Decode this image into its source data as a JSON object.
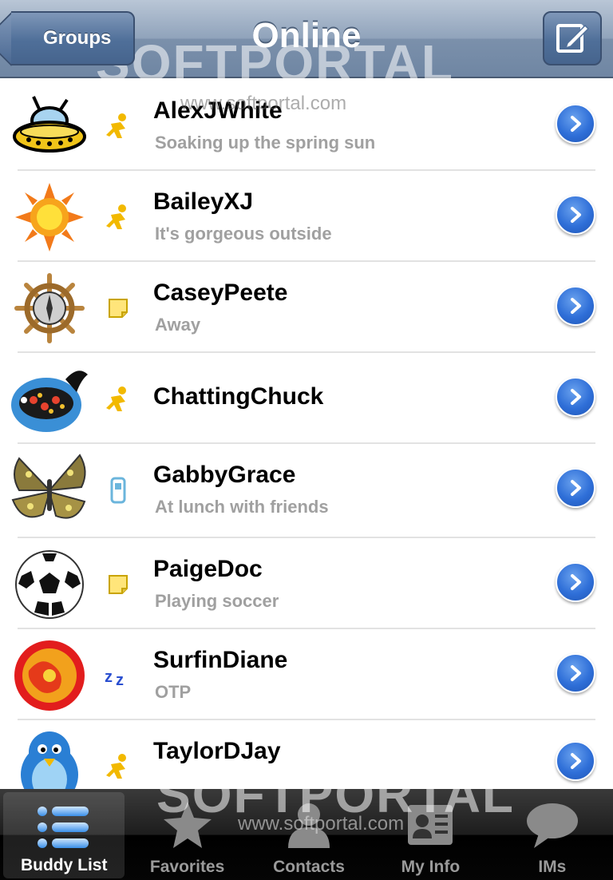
{
  "navbar": {
    "back_label": "Groups",
    "title": "Online"
  },
  "buddies": [
    {
      "name": "AlexJWhite",
      "status": "Soaking up the spring sun",
      "presence": "online-runner-icon",
      "avatar": "ufo-icon"
    },
    {
      "name": "BaileyXJ",
      "status": "It's gorgeous outside",
      "presence": "online-runner-icon",
      "avatar": "sun-icon"
    },
    {
      "name": "CaseyPeete",
      "status": "Away",
      "presence": "away-note-icon",
      "avatar": "ship-wheel-icon"
    },
    {
      "name": "ChattingChuck",
      "status": "",
      "presence": "online-runner-icon",
      "avatar": "fish-icon"
    },
    {
      "name": "GabbyGrace",
      "status": "At lunch with friends",
      "presence": "mobile-phone-icon",
      "avatar": "butterfly-icon"
    },
    {
      "name": "PaigeDoc",
      "status": "Playing soccer",
      "presence": "away-note-icon",
      "avatar": "soccer-ball-icon"
    },
    {
      "name": "SurfinDiane",
      "status": "OTP",
      "presence": "idle-zz-icon",
      "avatar": "red-flower-icon"
    },
    {
      "name": "TaylorDJay",
      "status": "",
      "presence": "online-runner-icon",
      "avatar": "penguin-icon"
    }
  ],
  "tabbar": {
    "tabs": [
      {
        "label": "Buddy List",
        "icon": "list-icon",
        "active": true
      },
      {
        "label": "Favorites",
        "icon": "star-icon",
        "active": false
      },
      {
        "label": "Contacts",
        "icon": "person-icon",
        "active": false
      },
      {
        "label": "My Info",
        "icon": "id-card-icon",
        "active": false
      },
      {
        "label": "IMs",
        "icon": "speech-bubble-icon",
        "active": false
      }
    ]
  },
  "watermark": {
    "brand": "SOFTPORTAL",
    "url": "www.softportal.com"
  },
  "colors": {
    "navbar": "#8a9fba",
    "disclosure": "#2f6fd8",
    "status_text": "#a0a0a0",
    "aim_yellow": "#f2b900"
  }
}
